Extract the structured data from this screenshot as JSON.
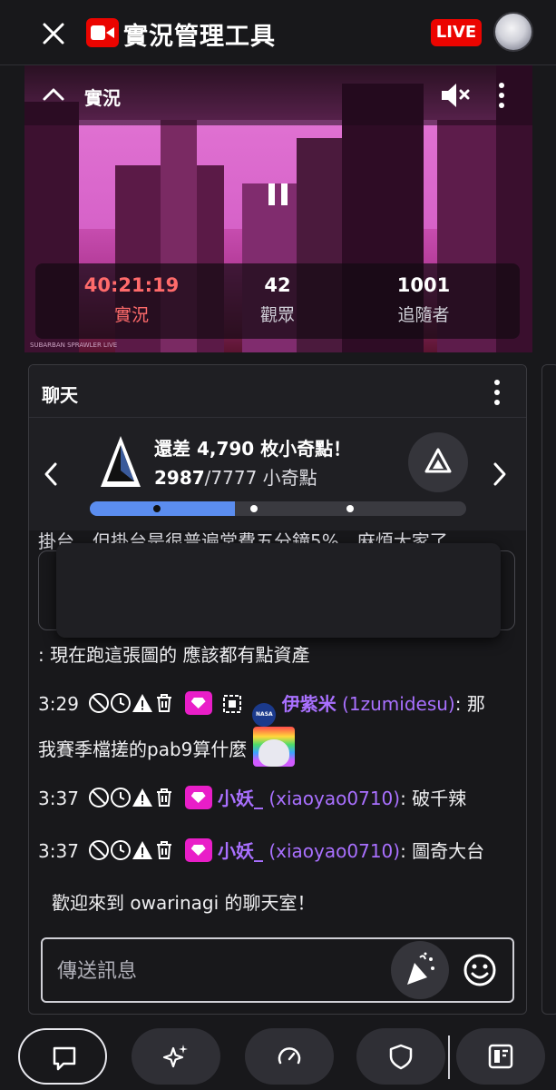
{
  "header": {
    "title": "實況管理工具",
    "live_label": "LIVE"
  },
  "video": {
    "label": "實況",
    "watermark": "SUBARBAN SPRAWLER LIVE",
    "stats": [
      {
        "value": "40:21:19",
        "label": "實況",
        "color": "#ff6b6b"
      },
      {
        "value": "42",
        "label": "觀眾"
      },
      {
        "value": "1001",
        "label": "追隨者"
      }
    ]
  },
  "chat": {
    "title": "聊天",
    "points": {
      "title": "還差 4,790 枚小奇點！",
      "current": "2987",
      "goal": "/7777 小奇點",
      "progress": 0.385,
      "stops": 3
    },
    "cut_text": "掛台，但掛台是很普遍常費五分鐘5%，麻煩大家了",
    "messages": [
      {
        "text": ": 現在跑這張圖的 應該都有點資產"
      },
      {
        "time": "3:29",
        "badge_extra": "NASA",
        "username": "伊紫米",
        "login": "(1zumidesu)",
        "text": ": 那",
        "text2": "我賽季檔搓的pab9算什麼"
      },
      {
        "time": "3:37",
        "username": "小妖_",
        "login": "(xiaoyao0710)",
        "text": ": 破千辣"
      },
      {
        "time": "3:37",
        "username": "小妖_",
        "login": "(xiaoyao0710)",
        "text": ": 圖奇大台"
      }
    ],
    "welcome": "歡迎來到 owarinagi 的聊天室！",
    "input_placeholder": "傳送訊息"
  },
  "bottom_nav": [
    {
      "icon": "chat-bubble-icon",
      "active": true
    },
    {
      "icon": "sparkle-icon"
    },
    {
      "icon": "speedometer-icon"
    },
    {
      "icon": "shield-icon"
    },
    {
      "icon": "stream-manager-icon"
    }
  ],
  "colors": {
    "background": "#18181b",
    "live_red": "#eb0400",
    "accent_purple": "#a970ff",
    "progress_blue": "#5b8def"
  }
}
